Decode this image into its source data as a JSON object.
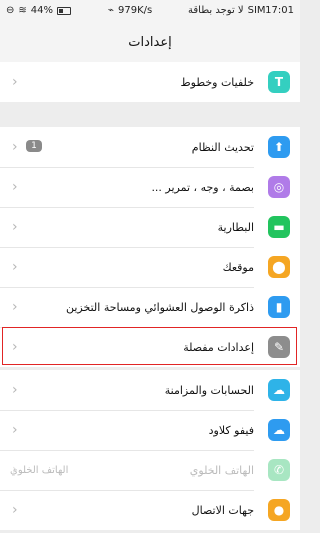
{
  "status_bar": {
    "time": "17:01",
    "carrier": "SIM",
    "no_sim_text": "لا توجد بطاقة",
    "speed": "979K/s",
    "battery": "44%",
    "battery_level": 0.44
  },
  "header": {
    "title": "إعدادات"
  },
  "groups": [
    [
      {
        "label": "خلفيات وخطوط",
        "icon_name": "themes-icon",
        "icon_char": "T",
        "color": "#34cfc0"
      }
    ],
    [
      {
        "label": "تحديث النظام",
        "icon_name": "system-update-icon",
        "icon_char": "⬆",
        "color": "#2e9bf0",
        "badge": "1"
      },
      {
        "label": "بصمة ، وجه ، تمرير ...",
        "icon_name": "fingerprint-icon",
        "icon_char": "◎",
        "color": "#b07be8"
      },
      {
        "label": "البطارية",
        "icon_name": "battery-icon",
        "icon_char": "▬",
        "color": "#22c45e"
      },
      {
        "label": "موقعك",
        "icon_name": "location-icon",
        "icon_char": "⬤",
        "color": "#f5a623"
      },
      {
        "label": "ذاكرة الوصول العشوائي ومساحة التخزين",
        "icon_name": "storage-icon",
        "icon_char": "▮",
        "color": "#2e9bf0"
      },
      {
        "label": "إعدادات مفصلة",
        "icon_name": "wrench-icon",
        "icon_char": "✎",
        "color": "#8d8d8d",
        "highlighted": true
      }
    ],
    [
      {
        "label": "الحسابات والمزامنة",
        "icon_name": "accounts-sync-icon",
        "icon_char": "☁",
        "color": "#2eb3e8"
      },
      {
        "label": "فيفو كلاود",
        "icon_name": "cloud-icon",
        "icon_char": "☁",
        "color": "#2e9bf0"
      },
      {
        "label": "الهاتف الخلوي",
        "icon_name": "phone-icon",
        "icon_char": "✆",
        "color": "#a8e6c2",
        "disabled": true,
        "value": "الهاتف الخلوي"
      },
      {
        "label": "جهات الاتصال",
        "icon_name": "contacts-icon",
        "icon_char": "●",
        "color": "#f5a623"
      }
    ]
  ]
}
